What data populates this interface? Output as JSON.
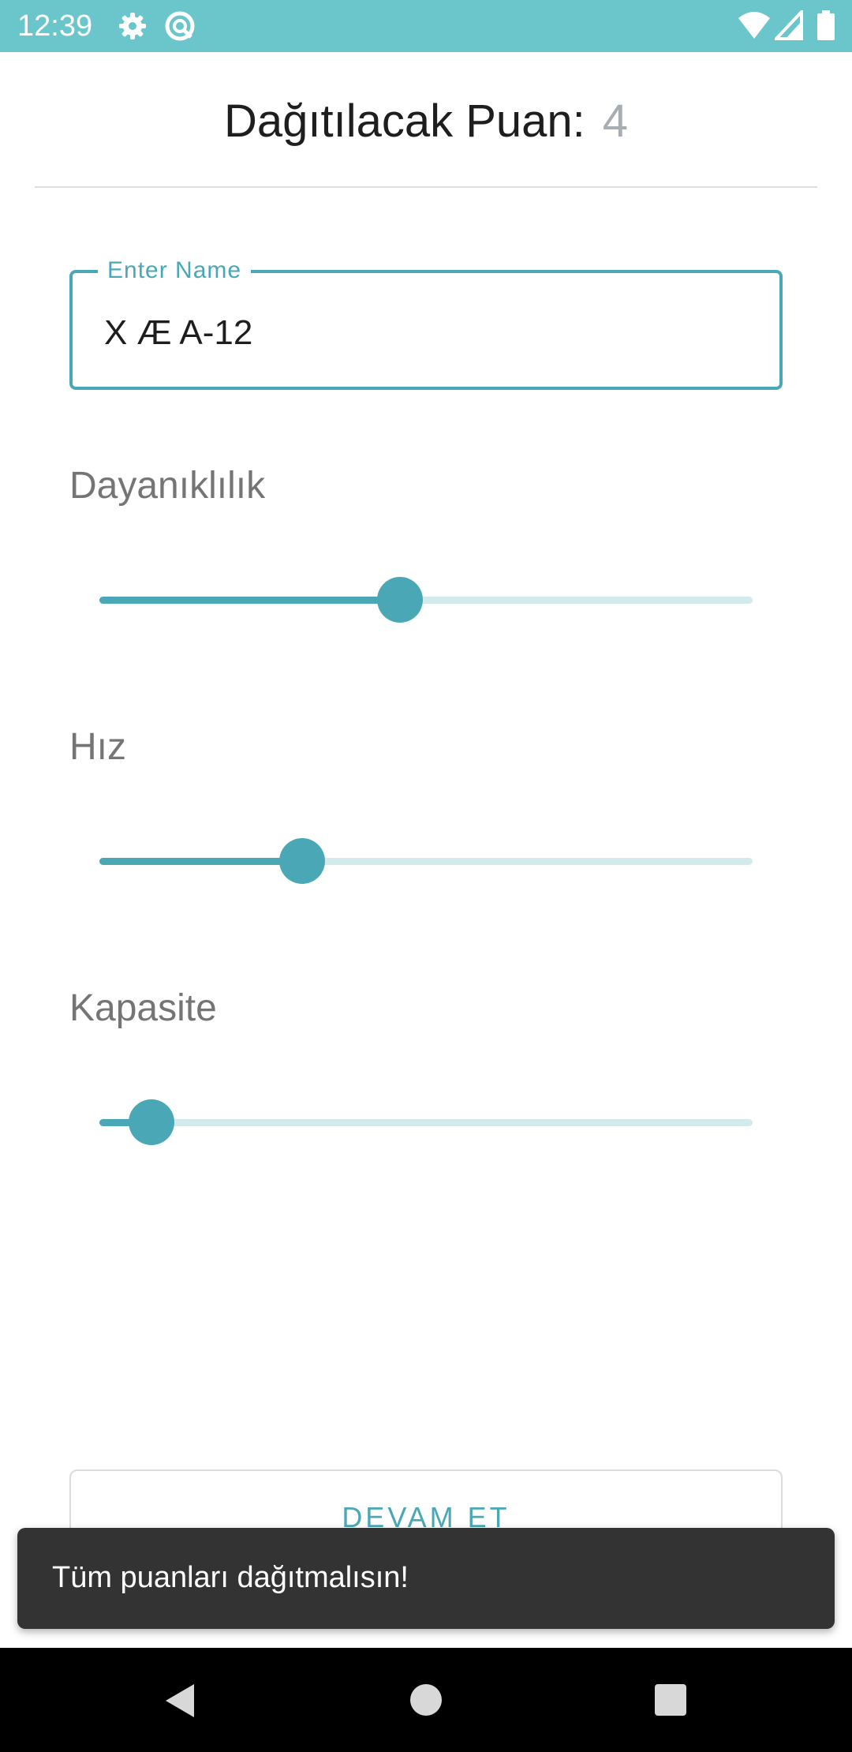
{
  "status_bar": {
    "time": "12:39",
    "icons": [
      "gear-icon",
      "sync-circle-icon",
      "wifi-icon",
      "signal-icon",
      "battery-icon"
    ],
    "background_color": "#6ac6cb"
  },
  "header": {
    "label": "Dağıtılacak Puan:",
    "points_remaining": "4"
  },
  "name_field": {
    "label": "Enter Name",
    "value": "X Æ A-12"
  },
  "stats": [
    {
      "label": "Dayanıklılık",
      "value_fraction": 0.46
    },
    {
      "label": "Hız",
      "value_fraction": 0.31
    },
    {
      "label": "Kapasite",
      "value_fraction": 0.08
    }
  ],
  "continue_button": {
    "label": "DEVAM ET"
  },
  "snackbar": {
    "message": "Tüm puanları dağıtmalısın!"
  },
  "nav_bar": {
    "icons": [
      "back-icon",
      "home-icon",
      "recents-icon"
    ]
  },
  "colors": {
    "accent": "#4aa8b6",
    "track": "#d2eaec",
    "snackbar": "#333333"
  }
}
